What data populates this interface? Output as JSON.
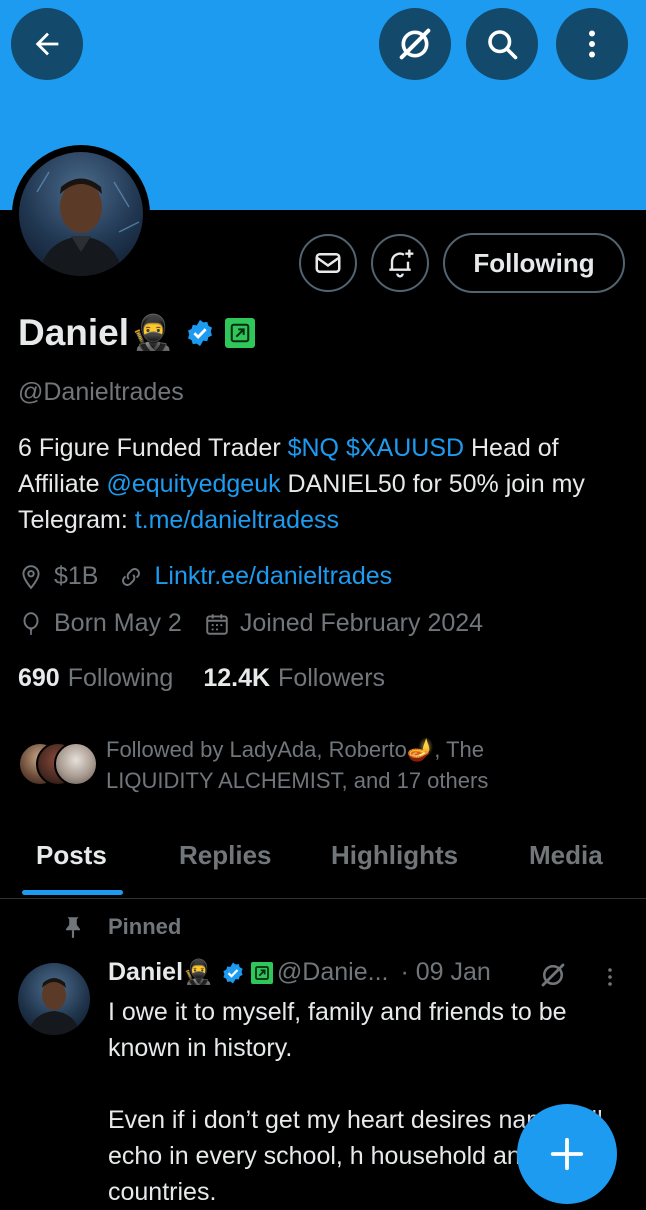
{
  "header": {
    "back_icon": "arrow-left-icon",
    "grok_icon": "slashed-circle-icon",
    "search_icon": "search-icon",
    "more_icon": "vertical-dots-icon",
    "banner_color": "#1d9bf0"
  },
  "profile": {
    "display_name": "Daniel",
    "name_emoji": "🥷",
    "handle": "@Danieltrades",
    "follow_button_label": "Following",
    "message_icon": "envelope-icon",
    "notify_icon": "bell-plus-icon",
    "bio": {
      "part1": "6 Figure Funded Trader ",
      "link1": "$NQ",
      "space1": " ",
      "link2": "$XAUUSD",
      "part2": " Head of Affiliate ",
      "link3": "@equityedgeuk",
      "part3": " DANIEL50 for 50% join my Telegram: ",
      "link4": "t.me/danieltradess"
    },
    "location": "$1B",
    "website": "Linktr.ee/danieltrades",
    "birthday": "Born May 2",
    "joined": "Joined February 2024",
    "following_count": "690",
    "following_label": "Following",
    "followers_count": "12.4K",
    "followers_label": "Followers",
    "followed_by_line1": "Followed by LadyAda, Roberto🪔, The",
    "followed_by_line2": "LIQUIDITY ALCHEMIST, and 17 others"
  },
  "tabs": [
    {
      "label": "Posts",
      "active": true
    },
    {
      "label": "Replies",
      "active": false
    },
    {
      "label": "Highlights",
      "active": false
    },
    {
      "label": "Media",
      "active": false
    }
  ],
  "pinned_post": {
    "pinned_label": "Pinned",
    "author_name": "Daniel",
    "author_emoji": "🥷",
    "author_handle": "@Danie...",
    "date": "· 09 Jan",
    "text": "I owe it to myself, family and friends to be known in history.\n\nEven if i don’t get my heart desires name will echo in every school, h household and countries."
  },
  "fab": {
    "icon": "plus-icon"
  },
  "colors": {
    "accent": "#1d9bf0",
    "muted": "#71767b",
    "verified_green": "#2fc65a"
  }
}
